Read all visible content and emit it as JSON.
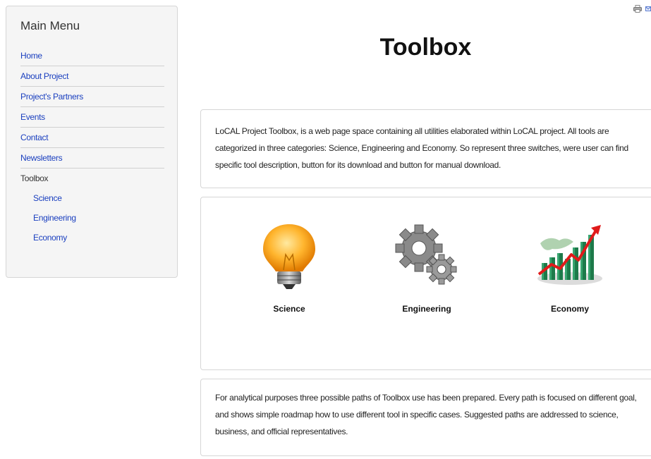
{
  "sidebar": {
    "title": "Main Menu",
    "items": [
      {
        "label": "Home"
      },
      {
        "label": "About Project"
      },
      {
        "label": "Project's Partners"
      },
      {
        "label": "Events"
      },
      {
        "label": "Contact"
      },
      {
        "label": "Newsletters"
      },
      {
        "label": "Toolbox"
      }
    ],
    "subitems": [
      {
        "label": "Science"
      },
      {
        "label": "Engineering"
      },
      {
        "label": "Economy"
      }
    ]
  },
  "header": {
    "icons": [
      "printer-icon",
      "email-icon"
    ]
  },
  "main": {
    "title": "Toolbox",
    "intro": "LoCAL Project Toolbox, is a web page space containing all utilities elaborated within LoCAL project. All tools are categorized in three categories: Science, Engineering and Economy. So represent three switches, were user can find specific tool description, button for its download and button for manual download.",
    "tools": [
      {
        "label": "Science",
        "icon": "lightbulb-icon"
      },
      {
        "label": "Engineering",
        "icon": "gears-icon"
      },
      {
        "label": "Economy",
        "icon": "growth-chart-icon"
      }
    ],
    "outro": "For analytical purposes three possible paths of Toolbox use has been prepared. Every path is focused on different goal, and shows simple roadmap how to use different tool in specific cases. Suggested paths are addressed to science, business, and official representatives."
  },
  "colors": {
    "link": "#1a3fbf",
    "sidebar_bg": "#f5f5f5",
    "border": "#d6d6d6"
  }
}
